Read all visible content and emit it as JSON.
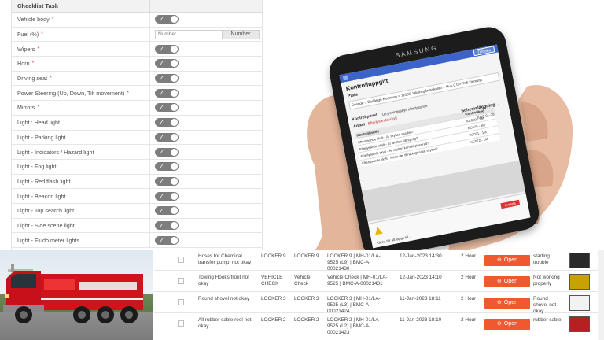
{
  "checklist": {
    "header": "Checklist Task",
    "items": [
      {
        "label": "Vehicle body",
        "required": true,
        "type": "toggle"
      },
      {
        "label": "Fuel (%)",
        "required": true,
        "type": "number",
        "placeholder": "Number",
        "button": "Number"
      },
      {
        "label": "Wipers",
        "required": true,
        "type": "toggle"
      },
      {
        "label": "Horn",
        "required": true,
        "type": "toggle"
      },
      {
        "label": "Driving seat",
        "required": true,
        "type": "toggle"
      },
      {
        "label": "Power Steering (Up, Down, Tilt movement)",
        "required": true,
        "type": "toggle"
      },
      {
        "label": "Mirrors",
        "required": true,
        "type": "toggle"
      },
      {
        "label": "Light : Head light",
        "required": false,
        "type": "toggle"
      },
      {
        "label": "Light - Parking light",
        "required": false,
        "type": "toggle"
      },
      {
        "label": "Light - Indicators / Hazard light",
        "required": false,
        "type": "toggle"
      },
      {
        "label": "Light - Fog light",
        "required": false,
        "type": "toggle"
      },
      {
        "label": "Light - Red flash light",
        "required": false,
        "type": "toggle"
      },
      {
        "label": "Light - Beacon light",
        "required": false,
        "type": "toggle"
      },
      {
        "label": "Light - Top search light",
        "required": false,
        "type": "toggle"
      },
      {
        "label": "Light - Side scene light",
        "required": false,
        "type": "toggle"
      },
      {
        "label": "Light - Fludo meter lights",
        "required": false,
        "type": "toggle"
      }
    ],
    "required_marker": "*",
    "toggle_check": "✓"
  },
  "tablet": {
    "brand": "SAMSUNG",
    "top_button": "Tillbaka",
    "title": "Kontrolluppgift",
    "plats_label": "Plats",
    "path": "Sverige > Borlänge Kommun > 11036 Jakobsgårdsskolan > Hus 0.0 > 705 Hemvist",
    "kontrollpunkt_label": "Kontrollpunkt",
    "kontrollpunkt_value": "Utrymningsskylt efterlysande",
    "schedule_label": "Schemaläggning...",
    "schedule_date": "2018-01-29",
    "artikel_label": "Artikel",
    "artikel_value": "Efterlysande skylt",
    "table_headers": [
      "Kontrollpunkt",
      "Kontrollkod"
    ],
    "table_rows": [
      [
        "Efterlysande skylt - Är skylten skadad?",
        "KC069 - 1M"
      ],
      [
        "Efterlysande skylt - Är skylten väl synlig?",
        "KC070 - 1M"
      ],
      [
        "Efterlysande skylt - Är skylten korrekt placerad?",
        "KC071 - 1M"
      ],
      [
        "Efterlysande skylt - Finns det tillräckligt antal skyltar?",
        "KC072 - 1M"
      ]
    ],
    "footer_text": "Klicka för att lägga till...",
    "footer_button": "Avsluta"
  },
  "defects": {
    "rows": [
      {
        "description": "Hoses for Chemical transfer pump, not okay",
        "loc1": "LOCKER 9",
        "loc2": "LOCKER 9",
        "full_location": "LOCKER 9 | MH-01/LA-9525 (L9) | BMC-A-00021430",
        "date": "12-Jan-2023 14:30",
        "duration": "2 Hour",
        "action": "Open",
        "note": "starting trouble"
      },
      {
        "description": "Towing Hooks front not okay",
        "loc1": "VEHICLE CHECK",
        "loc2": "Vehicle Check",
        "full_location": "Vehicle Check | MH-01/LA-9525 | BMC-A-00021431",
        "date": "12-Jan-2023 14:10",
        "duration": "2 Hour",
        "action": "Open",
        "note": "Not working properly"
      },
      {
        "description": "Round shovel not okay",
        "loc1": "LOCKER 3",
        "loc2": "LOCKER 3",
        "full_location": "LOCKER 3 | MH-01/LA-9525 (L3) | BMC-A-00021424",
        "date": "11-Jan-2023 18:11",
        "duration": "2 Hour",
        "action": "Open",
        "note": "Round shovel not okay"
      },
      {
        "description": "All rubber cable reel not okay",
        "loc1": "LOCKER 2",
        "loc2": "LOCKER 2",
        "full_location": "LOCKER 2 | MH-01/LA-9525 (L2) | BMC-A-00021423",
        "date": "11-Jan-2023 18:10",
        "duration": "2 Hour",
        "action": "Open",
        "note": "rubber cable"
      }
    ]
  },
  "colors": {
    "open_button": "#f0582e",
    "toggle_on": "#7d7d7d",
    "truck_body": "#d0141c",
    "tablet_header": "#3c64c8"
  }
}
